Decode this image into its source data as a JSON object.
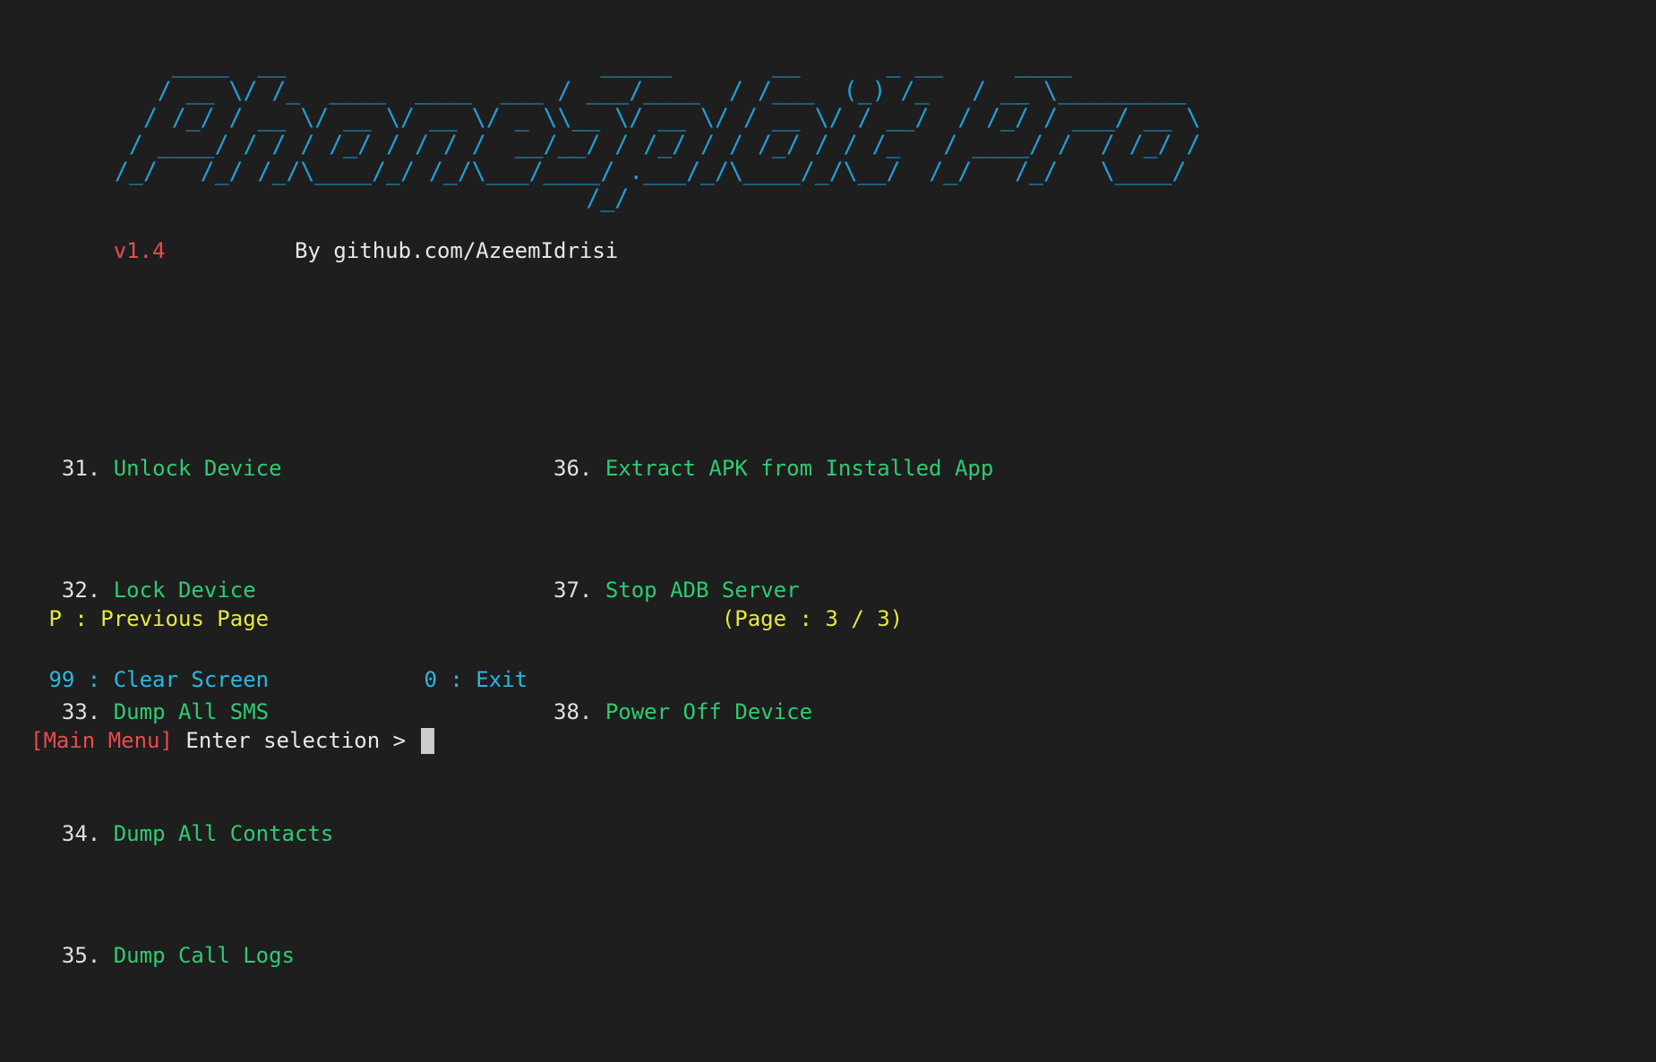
{
  "terminal": {
    "background_color": "#1e1e1e",
    "banner_color": "#1f9fd8",
    "banner_ascii": "      ____  __                      _____       __      _ __     ____           \n     / __ \\/ /_  ____  ____  ___ / ___/____  / /___  (_) /_   / __ \\_________\n    / /_/ / __ \\/ __ \\/ __ \\/ _ \\\\__ \\/ __ \\/ / __ \\/ / __/  / /_/ / ___/ __ \\\n   / ____/ / / / /_/ / / / /  __/__/ / /_/ / / /_/ / / /_   / ____/ /  / /_/ /\n  /_/   /_/ /_/\\____/_/ /_/\\___/____/ .___/_/\\____/_/\\__/  /_/   /_/   \\____/\n                                   /_/                                        "
  },
  "meta": {
    "version": "v1.4",
    "version_color": "#e84c4c",
    "byline": "By github.com/AzeemIdrisi",
    "byline_color": "#e8e8e8",
    "spacer": "          ",
    "indent": "      "
  },
  "menu": {
    "number_color": "#e0e0e0",
    "label_color": "#2ecc71",
    "column_gap": "       ",
    "indent": "  ",
    "rows": [
      {
        "left": {
          "number": "31.",
          "label": "Unlock Device",
          "pad": "              "
        },
        "right": {
          "number": "36.",
          "label": "Extract APK from Installed App"
        }
      },
      {
        "left": {
          "number": "32.",
          "label": "Lock Device",
          "pad": "                "
        },
        "right": {
          "number": "37.",
          "label": "Stop ADB Server"
        }
      },
      {
        "left": {
          "number": "33.",
          "label": "Dump All SMS",
          "pad": "               "
        },
        "right": {
          "number": "38.",
          "label": "Power Off Device"
        }
      },
      {
        "left": {
          "number": "34.",
          "label": "Dump All Contacts",
          "pad": ""
        },
        "right": {
          "number": "",
          "label": ""
        }
      },
      {
        "left": {
          "number": "35.",
          "label": "Dump Call Logs",
          "pad": ""
        },
        "right": {
          "number": "",
          "label": ""
        }
      }
    ]
  },
  "pager": {
    "color": "#e8e83c",
    "previous_page": " P : Previous Page",
    "spacer": "                                   ",
    "page_indicator": "(Page : 3 / 3)"
  },
  "utility": {
    "color": "#29b8e0",
    "clear_screen": " 99 : Clear Screen",
    "spacer": "            ",
    "exit": "0 : Exit"
  },
  "prompt": {
    "context": "[Main Menu]",
    "context_color": "#e84c4c",
    "text": " Enter selection > ",
    "text_color": "#e8e8e8",
    "cursor_color": "#cccccc"
  }
}
